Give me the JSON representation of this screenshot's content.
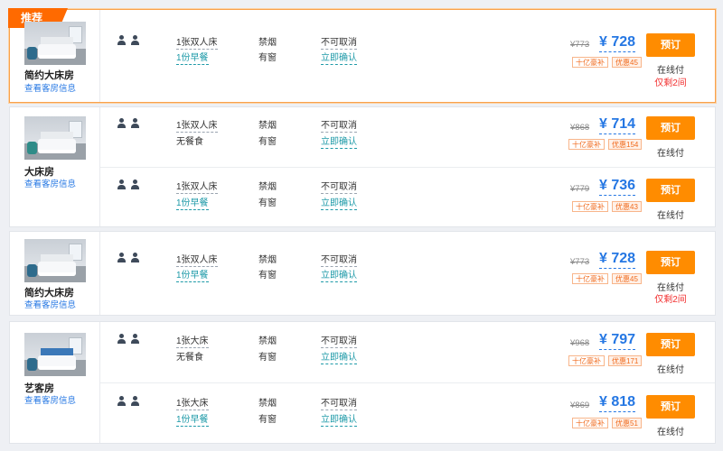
{
  "ribbon": "推荐",
  "rooms": [
    {
      "name": "简约大床房",
      "link": "查看客房信息",
      "offers": [
        {
          "bed": "1张双人床",
          "meal": "1份早餐",
          "smoke": "禁烟",
          "window": "有窗",
          "cancel": "不可取消",
          "confirm": "立即确认",
          "orig": "¥773",
          "price": "¥ 728",
          "subsidy": "十亿豪补",
          "discount": "优惠45",
          "book": "预订",
          "pay": "在线付",
          "remain": "仅剩2间"
        }
      ]
    },
    {
      "name": "大床房",
      "link": "查看客房信息",
      "offers": [
        {
          "bed": "1张双人床",
          "meal": "无餐食",
          "smoke": "禁烟",
          "window": "有窗",
          "cancel": "不可取消",
          "confirm": "立即确认",
          "orig": "¥868",
          "price": "¥ 714",
          "subsidy": "十亿豪补",
          "discount": "优惠154",
          "book": "预订",
          "pay": "在线付"
        },
        {
          "bed": "1张双人床",
          "meal": "1份早餐",
          "smoke": "禁烟",
          "window": "有窗",
          "cancel": "不可取消",
          "confirm": "立即确认",
          "orig": "¥779",
          "price": "¥ 736",
          "subsidy": "十亿豪补",
          "discount": "优惠43",
          "book": "预订",
          "pay": "在线付"
        }
      ]
    },
    {
      "name": "简约大床房",
      "link": "查看客房信息",
      "offers": [
        {
          "bed": "1张双人床",
          "meal": "1份早餐",
          "smoke": "禁烟",
          "window": "有窗",
          "cancel": "不可取消",
          "confirm": "立即确认",
          "orig": "¥773",
          "price": "¥ 728",
          "subsidy": "十亿豪补",
          "discount": "优惠45",
          "book": "预订",
          "pay": "在线付",
          "remain": "仅剩2间"
        }
      ]
    },
    {
      "name": "艺客房",
      "link": "查看客房信息",
      "offers": [
        {
          "bed": "1张大床",
          "meal": "无餐食",
          "smoke": "禁烟",
          "window": "有窗",
          "cancel": "不可取消",
          "confirm": "立即确认",
          "orig": "¥968",
          "price": "¥ 797",
          "subsidy": "十亿豪补",
          "discount": "优惠171",
          "book": "预订",
          "pay": "在线付"
        },
        {
          "bed": "1张大床",
          "meal": "1份早餐",
          "smoke": "禁烟",
          "window": "有窗",
          "cancel": "不可取消",
          "confirm": "立即确认",
          "orig": "¥869",
          "price": "¥ 818",
          "subsidy": "十亿豪补",
          "discount": "优惠51",
          "book": "预订",
          "pay": "在线付"
        }
      ]
    }
  ]
}
